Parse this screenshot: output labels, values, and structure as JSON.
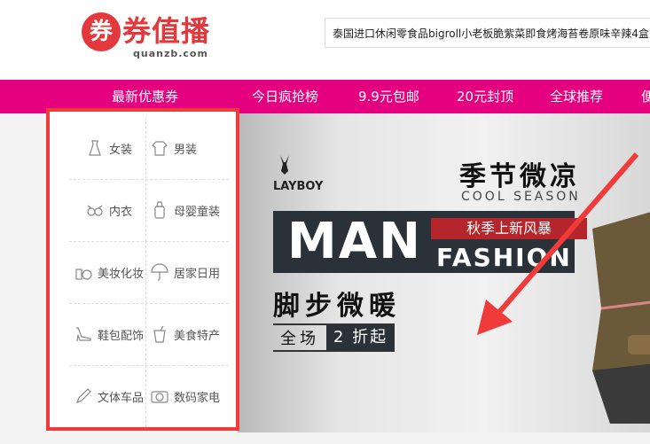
{
  "logo": {
    "mark": "券",
    "name": "券值播",
    "domain": "quanzb.com"
  },
  "search": {
    "value": "泰国进口休闲零食品bigroll小老板脆紫菜即食烤海苔卷原味辛辣4盒"
  },
  "nav": {
    "items": [
      {
        "label": "最新优惠券"
      },
      {
        "label": "今日疯抢榜"
      },
      {
        "label": "9.9元包邮"
      },
      {
        "label": "20元封顶"
      },
      {
        "label": "全球推荐"
      },
      {
        "label": "便"
      }
    ]
  },
  "categories": [
    {
      "left": {
        "label": "女装",
        "icon": "dress-icon"
      },
      "right": {
        "label": "男装",
        "icon": "shirt-icon"
      }
    },
    {
      "left": {
        "label": "内衣",
        "icon": "bra-icon"
      },
      "right": {
        "label": "母婴童装",
        "icon": "baby-bottle-icon"
      }
    },
    {
      "left": {
        "label": "美妆化妆",
        "icon": "cosmetics-icon"
      },
      "right": {
        "label": "居家日用",
        "icon": "umbrella-icon"
      }
    },
    {
      "left": {
        "label": "鞋包配饰",
        "icon": "high-heel-icon"
      },
      "right": {
        "label": "美食特产",
        "icon": "drink-icon"
      }
    },
    {
      "left": {
        "label": "文体车品",
        "icon": "pencil-icon"
      },
      "right": {
        "label": "数码家电",
        "icon": "camera-icon"
      }
    }
  ],
  "banner": {
    "brand": "LAYBOY",
    "season_cn": "季节微凉",
    "season_en": "COOL SEASON",
    "man": "MAN",
    "tag": "秋季上新风暴",
    "fashion": "FASHION",
    "warm": "脚步微暖",
    "sale_a": "全场",
    "sale_b": "2 折起"
  },
  "colors": {
    "accent": "#e4007f",
    "brand": "#e4393c",
    "highlight_border": "#f03b3b"
  }
}
